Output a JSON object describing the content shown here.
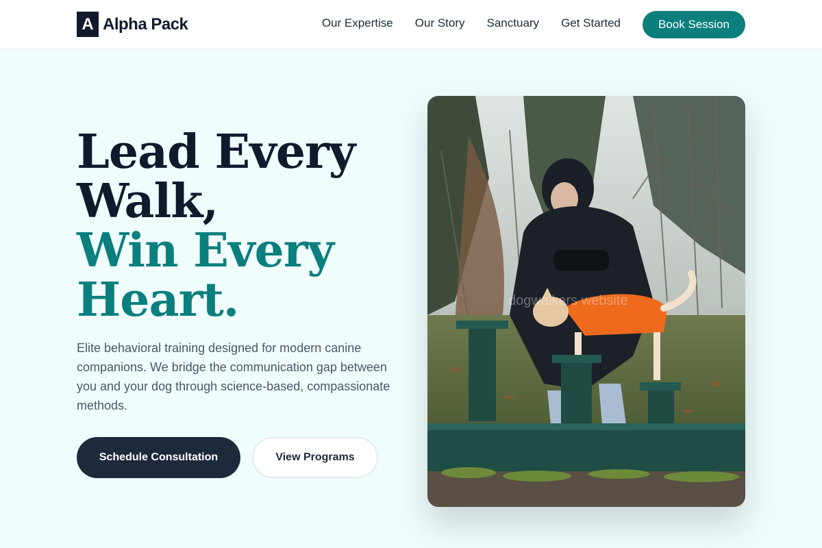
{
  "brand": {
    "mark": "A",
    "name": "Alpha Pack"
  },
  "nav": {
    "links": [
      "Our Expertise",
      "Our Story",
      "Sanctuary",
      "Get Started"
    ],
    "cta": "Book Session"
  },
  "hero": {
    "title_lines": [
      "Lead Every",
      "Walk,"
    ],
    "title_accent_lines": [
      "Win Every",
      "Heart."
    ],
    "description": "Elite behavioral training designed for modern canine companions. We bridge the communication gap between you and your dog through science-based, compassionate methods.",
    "primary_cta": "Schedule Consultation",
    "secondary_cta": "View Programs",
    "photo_watermark": "dogwalkers website"
  },
  "colors": {
    "accent": "#0b7f7d",
    "dark": "#0f1b2d",
    "background": "#f0fdfd"
  }
}
